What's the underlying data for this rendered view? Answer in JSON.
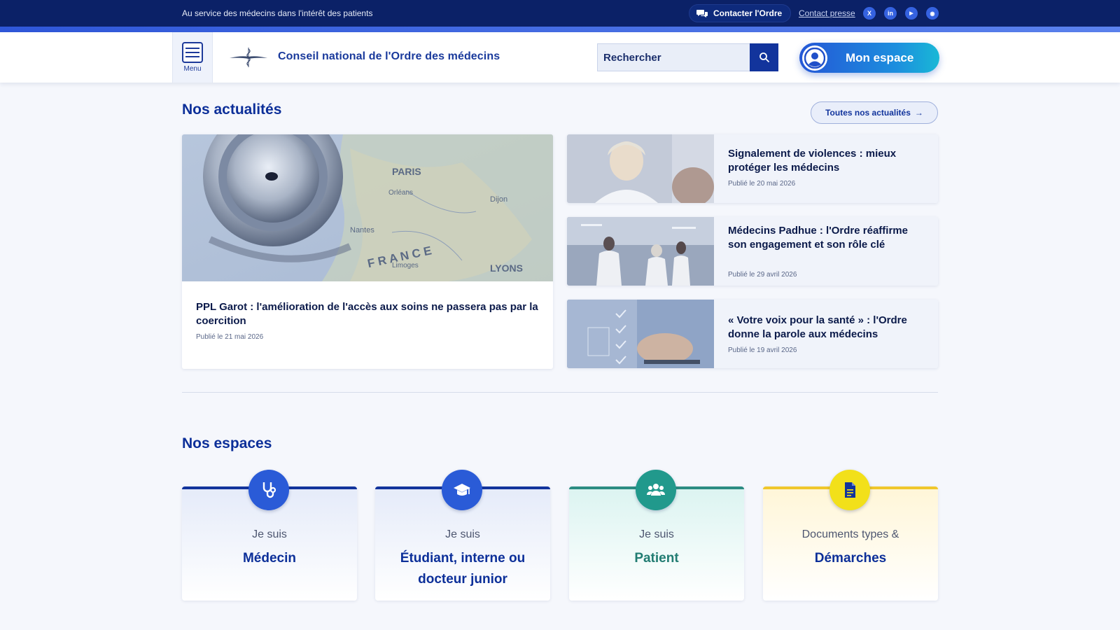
{
  "topbar": {
    "tagline": "Au service des médecins dans l'intérêt des patients",
    "contact_label": "Contacter l'Ordre",
    "press_label": "Contact presse",
    "social": [
      {
        "name": "x",
        "glyph": "X"
      },
      {
        "name": "linkedin",
        "glyph": "in"
      },
      {
        "name": "youtube",
        "glyph": "▶"
      },
      {
        "name": "rss",
        "glyph": "◉"
      }
    ]
  },
  "header": {
    "menu_label": "Menu",
    "site_title": "Conseil national de l'Ordre des médecins",
    "search_placeholder": "Rechercher",
    "space_label": "Mon espace"
  },
  "news": {
    "title": "Nos actualités",
    "all_label": "Toutes nos actualités",
    "featured": {
      "title": "PPL Garot : l'amélioration de l'accès aux soins ne passera pas par la coercition",
      "date": "Publié le 21 mai 2026"
    },
    "items": [
      {
        "title": "Signalement de violences : mieux protéger les médecins",
        "date": "Publié le 20 mai 2026"
      },
      {
        "title": "Médecins Padhue : l'Ordre réaffirme son engagement et son rôle clé",
        "date": "Publié le 29 avril 2026"
      },
      {
        "title": "« Votre voix pour la santé » : l'Ordre donne la parole aux médecins",
        "date": "Publié le 19 avril 2026"
      }
    ],
    "map_labels": [
      "PARIS",
      "Orléans",
      "Nantes",
      "Dijon",
      "Limoges",
      "LYONS",
      "F R A N C E"
    ]
  },
  "spaces": {
    "title": "Nos espaces",
    "cards": [
      {
        "pre": "Je suis",
        "main": "Médecin",
        "icon": "stethoscope-icon"
      },
      {
        "pre": "Je suis",
        "main": "Étudiant, interne ou docteur junior",
        "icon": "graduation-cap-icon"
      },
      {
        "pre": "Je suis",
        "main": "Patient",
        "icon": "users-icon"
      },
      {
        "pre": "Documents types &",
        "main": "Démarches",
        "icon": "document-icon"
      }
    ]
  }
}
